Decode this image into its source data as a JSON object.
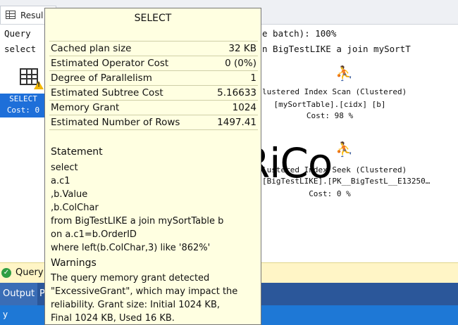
{
  "results_tab": {
    "label": "Resul"
  },
  "query_text": {
    "line1": "Query",
    "line1_end": "e batch): 100%",
    "line2": "select",
    "line2_end": "n BigTestLIKE a join mySortT"
  },
  "select_node": {
    "label": "SELECT",
    "cost": "Cost: 0"
  },
  "operators": [
    {
      "line1": "lustered Index Scan (Clustered)",
      "line2": "[mySortTable].[cidx] [b]",
      "cost": "Cost: 98 %"
    },
    {
      "line1": "lustered Index Seek (Clustered)",
      "line2": "[BigTestLIKE].[PK__BigTestL__E13250…",
      "cost": "Cost: 0 %"
    }
  ],
  "watermark": "RiCo",
  "status": {
    "label": "Query"
  },
  "output_panel": {
    "tab1": "Output",
    "tab2": "P"
  },
  "bottom_bar": {
    "text": "y"
  },
  "tooltip": {
    "title": "SELECT",
    "rows": [
      {
        "label": "Cached plan size",
        "value": "32 KB"
      },
      {
        "label": "Estimated Operator Cost",
        "value": "0 (0%)"
      },
      {
        "label": "Degree of Parallelism",
        "value": "1"
      },
      {
        "label": "Estimated Subtree Cost",
        "value": "5.16633"
      },
      {
        "label": "Memory Grant",
        "value": "1024"
      },
      {
        "label": "Estimated Number of Rows",
        "value": "1497.41"
      }
    ],
    "statement_heading": "Statement",
    "statement_lines": [
      "select",
      "a.c1",
      ",b.Value",
      ",b.ColChar",
      "from BigTestLIKE a join mySortTable b",
      "on a.c1=b.OrderID",
      "where left(b.ColChar,3) like '862%'"
    ],
    "warnings_heading": "Warnings",
    "warnings_lines": [
      "The query memory grant detected",
      "\"ExcessiveGrant\", which may impact the",
      "reliability. Grant size: Initial 1024 KB,",
      "Final 1024 KB, Used 16 KB."
    ]
  }
}
